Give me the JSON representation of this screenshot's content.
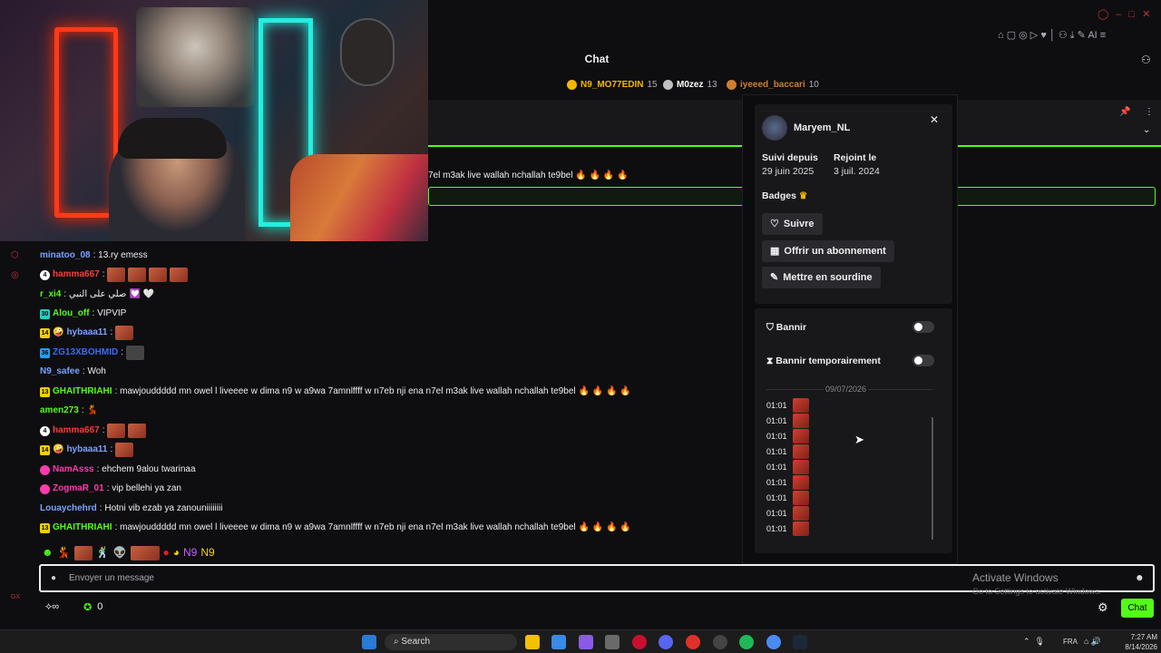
{
  "chat": {
    "title": "Chat"
  },
  "leaderboard": [
    {
      "name": "N9_MO77EDIN",
      "count": "15",
      "color": "#f5b800"
    },
    {
      "name": "M0zez",
      "count": "13",
      "color": "#c0c0c0"
    },
    {
      "name": "iyeeed_baccari",
      "count": "10",
      "color": "#cd7f32"
    }
  ],
  "pinned_highlight": "7el m3ak live wallah nchallah te9bel",
  "messages": [
    {
      "badge": "",
      "user": "minatoo_08",
      "color": "#7aa2ff",
      "text": ": 13.ry emess"
    },
    {
      "badge": "4",
      "user": "hamma667",
      "color": "#ff3a3a",
      "text": ":"
    },
    {
      "badge": "",
      "user": "r_xi4",
      "color": "#53fc18",
      "text": ": صلي على النبي"
    },
    {
      "badge": "30",
      "user": "Alou_off",
      "color": "#53fc18",
      "text": ": VIPVIP"
    },
    {
      "badge": "14",
      "user": "hybaaa11",
      "color": "#7aa2ff",
      "text": ":"
    },
    {
      "badge": "36",
      "user": "ZG13XBOHMID",
      "color": "#3a6aff",
      "text": ":"
    },
    {
      "badge": "",
      "user": "N9_safee",
      "color": "#7aa2ff",
      "text": ": Woh"
    },
    {
      "badge": "13",
      "user": "GHAITHRIAHI",
      "color": "#53fc18",
      "text": ": mawjouddddd mn owel l liveeee w dima n9 w a9wa 7amnlffff w n7eb nji ena n7el m3ak live wallah nchallah te9bel"
    },
    {
      "badge": "",
      "user": "amen273",
      "color": "#53fc18",
      "text": ":"
    },
    {
      "badge": "4",
      "user": "hamma667",
      "color": "#ff3a3a",
      "text": ":"
    },
    {
      "badge": "14",
      "user": "hybaaa11",
      "color": "#7aa2ff",
      "text": ":"
    },
    {
      "badge": "",
      "user": "NamAsss",
      "color": "#ff3ab0",
      "text": ": ehchem 9alou twarinaa"
    },
    {
      "badge": "",
      "user": "ZogmaR_01",
      "color": "#ff3ab0",
      "text": ": vip bellehi ya zan"
    },
    {
      "badge": "",
      "user": "Louaychehrd",
      "color": "#7aa2ff",
      "text": ": Hotni vib ezab ya zanouniiiiiiii"
    },
    {
      "badge": "13",
      "user": "GHAITHRIAHI",
      "color": "#53fc18",
      "text": ": mawjouddddd mn owel l liveeee w dima n9 w a9wa 7amnlffff w n7eb nji ena n7el m3ak live wallah nchallah te9bel"
    }
  ],
  "popup": {
    "username": "Maryem_NL",
    "followed_label": "Suivi depuis",
    "followed_date": "29 juin 2025",
    "joined_label": "Rejoint le",
    "joined_date": "3 juil. 2024",
    "badges_label": "Badges",
    "follow_btn": "Suivre",
    "gift_btn": "Offrir un abonnement",
    "mute_btn": "Mettre en sourdine",
    "ban_label": "Bannir",
    "timeout_label": "Bannir temporairement",
    "log_date": "09/07/2026",
    "log_times": [
      "01:01",
      "01:01",
      "01:01",
      "01:01",
      "01:01",
      "01:01",
      "01:01",
      "01:01",
      "01:01"
    ]
  },
  "input": {
    "placeholder": "Envoyer un message"
  },
  "bottom": {
    "viewers": "0",
    "chat_button": "Chat"
  },
  "watermark": {
    "line1": "Activate Windows",
    "line2": "Go to Settings to activate Windows."
  },
  "taskbar": {
    "search": "Search",
    "lang": "FRA",
    "time": "7:27 AM",
    "date": "8/14/2026"
  }
}
